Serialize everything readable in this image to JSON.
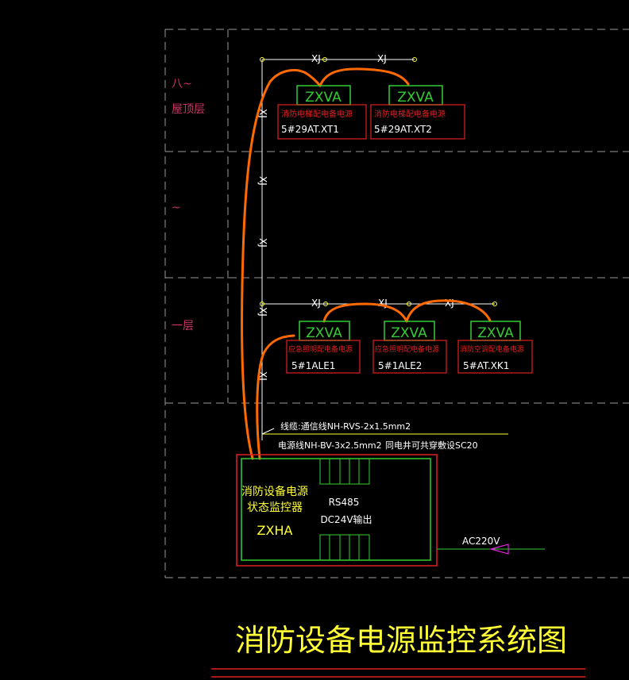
{
  "floors": {
    "roof_prefix": "八~",
    "roof": "屋顶层",
    "middle": "~",
    "first": "一层"
  },
  "cable_code": "XJ",
  "cable_code_vertical": "XJ",
  "modules": {
    "m1": {
      "model": "ZXVA",
      "desc": "消防电梯配电备电源",
      "id": "5#29AT.XT1"
    },
    "m2": {
      "model": "ZXVA",
      "desc": "消防电梯配电备电源",
      "id": "5#29AT.XT2"
    },
    "m3": {
      "model": "ZXVA",
      "desc": "应急照明配电备电源",
      "id": "5#1ALE1"
    },
    "m4": {
      "model": "ZXVA",
      "desc": "应急照明配电备电源",
      "id": "5#1ALE2"
    },
    "m5": {
      "model": "ZXVA",
      "desc": "消防空调配电备电源",
      "id": "5#AT.XK1"
    }
  },
  "wiring": {
    "signal": "线缆:通信线NH-RVS-2x1.5mm2",
    "power": "电源线NH-BV-3x2.5mm2",
    "conduit": "同电井可共穿敷设SC20"
  },
  "controller": {
    "name_line1": "消防设备电源",
    "name_line2": "状态监控器",
    "model": "ZXHA",
    "bus": "RS485",
    "output": "DC24V输出"
  },
  "supply": "AC220V",
  "title": "消防设备电源监控系统图",
  "colors": {
    "background": "#000000",
    "grid": "#9a9a9a",
    "module_green": "#33cc33",
    "desc_red": "#e02020",
    "cable_orange": "#ff6a00",
    "title_yellow": "#ffff33",
    "floor_label": "#cc3366"
  }
}
